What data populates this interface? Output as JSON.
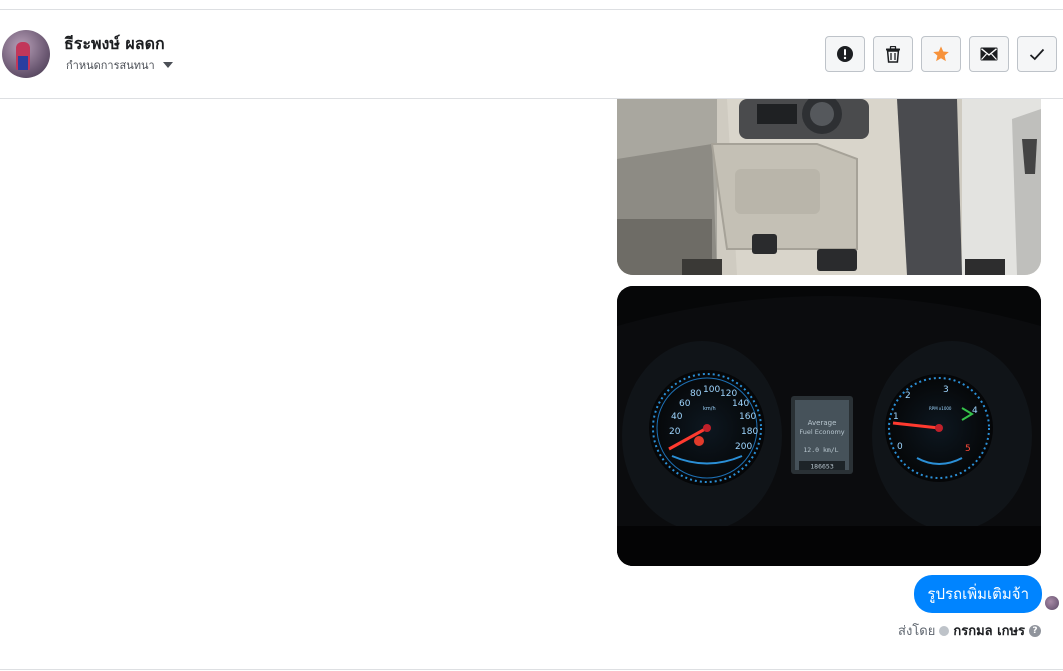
{
  "header": {
    "contact_name": "ธีระพงษ์ ผลดก",
    "conversation_settings": "กำหนดการสนทนา"
  },
  "actions": [
    {
      "name": "report-button",
      "icon": "exclamation-circle-icon"
    },
    {
      "name": "delete-button",
      "icon": "trash-icon"
    },
    {
      "name": "star-button",
      "icon": "star-icon",
      "color": "#f7923b"
    },
    {
      "name": "mark-unread-button",
      "icon": "envelope-icon"
    },
    {
      "name": "mark-done-button",
      "icon": "checkmark-icon"
    }
  ],
  "messages": {
    "last_text": "รูปรถเพิ่มเติมจ้า",
    "sent_by_prefix": "ส่งโดย",
    "sent_by_name": "กรกมล เกษร",
    "help": "?"
  },
  "dashboard_photo": {
    "speedo_ticks": [
      "20",
      "40",
      "60",
      "80",
      "100",
      "120",
      "140",
      "160",
      "180",
      "200"
    ],
    "speed_unit": "km/h",
    "info_line1": "Average",
    "info_line2": "Fuel Economy",
    "economy": "12.0 km/L",
    "odometer": "186653",
    "tacho_ticks": [
      "0",
      "1",
      "2",
      "3",
      "4",
      "5"
    ],
    "tacho_unit": "RPM x1000"
  },
  "colors": {
    "accent": "#0084ff",
    "star": "#f7923b"
  }
}
